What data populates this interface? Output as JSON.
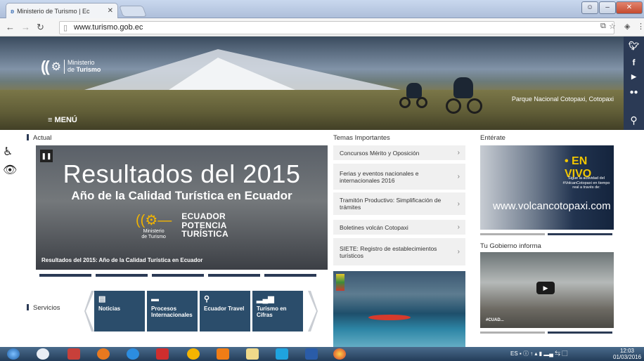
{
  "browser": {
    "tab_title": "Ministerio de Turismo | Ec",
    "url": "www.turismo.gob.ec"
  },
  "hero": {
    "logo_line1": "Ministerio",
    "logo_line2_prefix": "de ",
    "logo_line2_bold": "Turismo",
    "caption": "Parque Nacional Cotopaxi, Cotopaxi",
    "menu_label": "≡ MENÚ"
  },
  "sections": {
    "actual": "Actual",
    "servicios": "Servicios",
    "temas": "Temas Importantes",
    "enterate": "Entérate",
    "gobierno": "Tu Gobierno informa"
  },
  "slider": {
    "headline": "Resultados del 2015",
    "subheadline": "Año de la Calidad Turística en Ecuador",
    "logo_small_1": "Ministerio",
    "logo_small_2": "de Turismo",
    "brand_line1": "ECUADOR",
    "brand_line2": "POTENCIA",
    "brand_line3": "TURÍSTICA",
    "caption": "Resultados del 2015: Año de la Calidad Turística en Ecuador"
  },
  "services": [
    {
      "label": "Noticias",
      "icon": "document-icon"
    },
    {
      "label": "Procesos Internacionales",
      "icon": "folder-icon"
    },
    {
      "label": "Ecuador Travel",
      "icon": "location-pin-icon"
    },
    {
      "label": "Turismo en Cifras",
      "icon": "bar-chart-icon"
    }
  ],
  "temas": [
    "Concursos Mérito y Oposición",
    "Ferias y eventos nacionales e internacionales 2016",
    "Tramitón Productivo: Simplificación de trámites",
    "Boletines volcán Cotopaxi",
    "SIETE: Registro de establecimientos turísticos"
  ],
  "enterate": {
    "live": "• EN VIVO",
    "sub": "Sigue la actividad del #VolcanCotopaxi en tiempo real a través de:",
    "url": "www.volcancotopaxi.com"
  },
  "gobierno": {
    "tag": "#CUAD..."
  },
  "taskbar": {
    "lang": "ES",
    "time": "12:03",
    "date": "01/03/2016"
  },
  "colors": {
    "navy": "#2b3a55",
    "tile": "#2b4d6b",
    "live_yellow": "#f2c600"
  }
}
